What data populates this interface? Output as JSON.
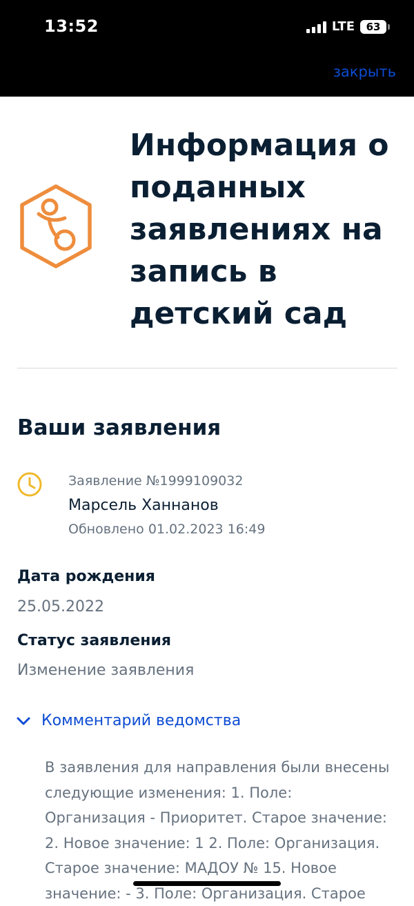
{
  "status_bar": {
    "time": "13:52",
    "network": "LTE",
    "battery": "63"
  },
  "header": {
    "close_label": "закрыть"
  },
  "page": {
    "title": "Информация о поданных заявлениях на запись в детский сад",
    "icon": "pacifier-hexagon-icon",
    "accent_color": "#ee8d3d"
  },
  "applications": {
    "section_title": "Ваши заявления",
    "item": {
      "icon": "clock-icon",
      "number": "Заявление №1999109032",
      "name": "Марсель Ханнанов",
      "updated": "Обновлено 01.02.2023 16:49"
    },
    "birth_date_label": "Дата рождения",
    "birth_date_value": "25.05.2022",
    "status_label": "Статус заявления",
    "status_value": "Изменение заявления",
    "comment_toggle_label": "Комментарий ведомства",
    "comment_text": "В заявления для направления были внесены следующие изменения: 1. Поле: Организация - Приоритет. Старое значение: 2. Новое значение: 1 2. Поле: Организация. Старое значение: МАДОУ № 15. Новое значение: - 3. Поле: Организация. Старое"
  },
  "colors": {
    "link": "#0d4cd3",
    "text_primary": "#0b1f33",
    "text_secondary": "#66727f",
    "clock_yellow": "#f0b92b"
  }
}
